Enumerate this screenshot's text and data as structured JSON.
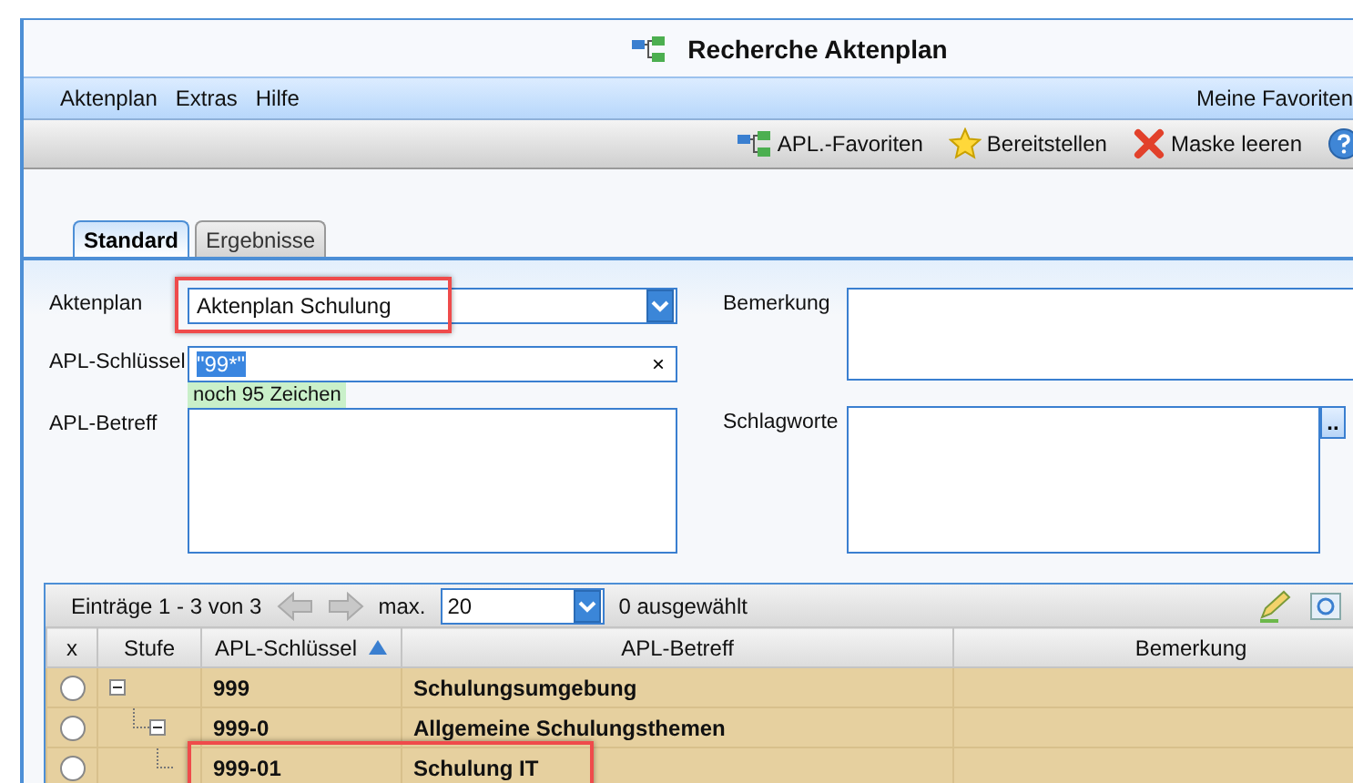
{
  "window": {
    "title": "Recherche Aktenplan"
  },
  "menu": {
    "items": [
      "Aktenplan",
      "Extras",
      "Hilfe"
    ],
    "right": "Meine Favoriten"
  },
  "toolbar": [
    {
      "kind": "favorites",
      "label": "APL.-Favoriten"
    },
    {
      "kind": "star",
      "label": "Bereitstellen"
    },
    {
      "kind": "clear",
      "label": "Maske leeren"
    },
    {
      "kind": "help"
    }
  ],
  "tabs": [
    {
      "label": "Standard",
      "selected": true
    },
    {
      "label": "Ergebnisse",
      "selected": false
    }
  ],
  "form": {
    "aktenplan": {
      "label": "Aktenplan",
      "value": "Aktenplan Schulung",
      "highlighted": true
    },
    "schluessel": {
      "label": "APL-Schlüssel",
      "value": "\"99*\"",
      "selected_text": true,
      "clear": "×",
      "hint": "noch 95 Zeichen"
    },
    "betreff": {
      "label": "APL-Betreff"
    },
    "bemerkung": {
      "label": "Bemerkung"
    },
    "schlagworte": {
      "label": "Schlagworte",
      "button": ".."
    }
  },
  "grid": {
    "paging": "Einträge 1 - 3 von 3",
    "max_label": "max.",
    "max_value": "20",
    "selected_count": "0 ausgewählt",
    "columns": [
      {
        "label": "x"
      },
      {
        "label": "Stufe"
      },
      {
        "label": "APL-Schlüssel",
        "sorted": true
      },
      {
        "label": "APL-Betreff"
      },
      {
        "label": "Bemerkung"
      }
    ],
    "rows": [
      {
        "key": "999",
        "betreff": "Schulungsumgebung",
        "selected": false,
        "expanded": true,
        "highlighted": false,
        "children": [
          {
            "key": "999-0",
            "betreff": "Allgemeine Schulungsthemen",
            "selected": false,
            "expanded": true,
            "highlighted": false,
            "children": [
              {
                "key": "999-01",
                "betreff": "Schulung IT",
                "selected": false,
                "highlighted": true
              }
            ]
          }
        ]
      }
    ]
  }
}
